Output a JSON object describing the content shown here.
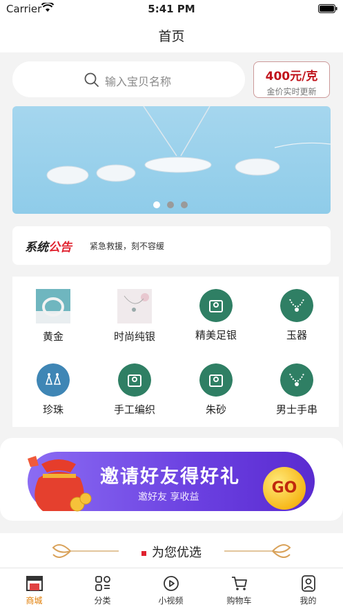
{
  "status_bar": {
    "carrier": "Carrier",
    "time": "5:41 PM"
  },
  "nav": {
    "title": "首页"
  },
  "search": {
    "placeholder": "输入宝贝名称"
  },
  "gold_price": {
    "price": "400元/克",
    "subtitle": "金价实时更新"
  },
  "banner": {
    "page_count": 3,
    "active_index": 0
  },
  "notice": {
    "brand_part1": "系统",
    "brand_part2": "公告",
    "text": "紧急救援，刻不容缓"
  },
  "categories": [
    {
      "label": "黄金",
      "icon": "bracelet-photo"
    },
    {
      "label": "时尚纯银",
      "icon": "silver-necklace-photo"
    },
    {
      "label": "精美足银",
      "icon": "ring-box-icon"
    },
    {
      "label": "玉器",
      "icon": "necklace-icon"
    },
    {
      "label": "珍珠",
      "icon": "earrings-icon"
    },
    {
      "label": "手工编织",
      "icon": "ring-box-icon"
    },
    {
      "label": "朱砂",
      "icon": "ring-box-icon"
    },
    {
      "label": "男士手串",
      "icon": "necklace-icon"
    }
  ],
  "invite": {
    "title": "邀请好友得好礼",
    "subtitle": "邀好友  享收益",
    "go": "GO"
  },
  "recommend": {
    "label": "为您优选"
  },
  "tabs": [
    {
      "label": "商城",
      "icon": "store-icon",
      "active": true
    },
    {
      "label": "分类",
      "icon": "category-icon",
      "active": false
    },
    {
      "label": "小视频",
      "icon": "play-icon",
      "active": false
    },
    {
      "label": "购物车",
      "icon": "cart-icon",
      "active": false
    },
    {
      "label": "我的",
      "icon": "user-icon",
      "active": false
    }
  ],
  "colors": {
    "accent_red": "#c0131b",
    "tab_active": "#e07b00",
    "category_circle": "#2f7f64",
    "pearl_circle": "#3f86b5"
  }
}
